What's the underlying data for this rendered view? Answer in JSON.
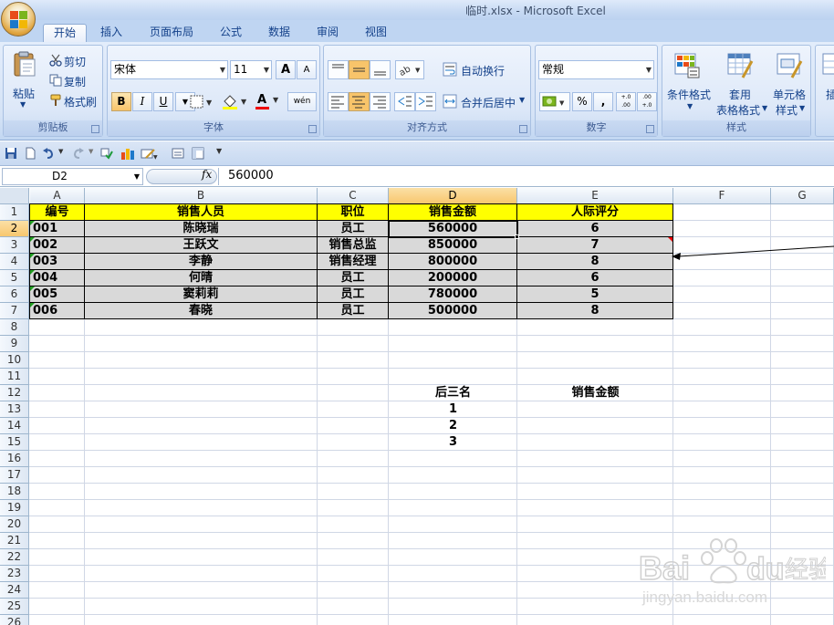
{
  "window": {
    "title": "临时.xlsx - Microsoft Excel"
  },
  "tabs": [
    "开始",
    "插入",
    "页面布局",
    "公式",
    "数据",
    "审阅",
    "视图"
  ],
  "ribbon": {
    "clipboard": {
      "label": "剪贴板",
      "paste": "粘贴",
      "cut": "剪切",
      "copy": "复制",
      "format_painter": "格式刷"
    },
    "font": {
      "label": "字体",
      "name": "宋体",
      "size": "11",
      "bold": "B",
      "italic": "I",
      "underline": "U",
      "grow": "A",
      "shrink": "A",
      "phonetic": "wén",
      "font_color_glyph": "A"
    },
    "alignment": {
      "label": "对齐方式",
      "wrap": "自动换行",
      "merge": "合并后居中"
    },
    "number": {
      "label": "数字",
      "format": "常规",
      "percent": "%",
      "comma": ",",
      "inc_decimal": "+.0 .00",
      "dec_decimal": ".00 +.0"
    },
    "styles": {
      "label": "样式",
      "conditional": "条件格式",
      "table_line1": "套用",
      "table_line2": "表格格式",
      "cell_line1": "单元格",
      "cell_line2": "样式"
    },
    "insert_partial": "插"
  },
  "formula_bar": {
    "name_box": "D2",
    "fx": "fx",
    "value": "560000"
  },
  "columns": [
    "A",
    "B",
    "C",
    "D",
    "E",
    "F",
    "G"
  ],
  "rows": [
    "1",
    "2",
    "3",
    "4",
    "5",
    "6",
    "7",
    "8",
    "9",
    "10",
    "11",
    "12",
    "13",
    "14",
    "15",
    "16",
    "17",
    "18",
    "19",
    "20",
    "21",
    "22",
    "23",
    "24",
    "25",
    "26"
  ],
  "table": {
    "headers": [
      "编号",
      "销售人员",
      "职位",
      "销售金额",
      "人际评分"
    ],
    "rows": [
      [
        "001",
        "陈晓瑞",
        "员工",
        "560000",
        "6"
      ],
      [
        "002",
        "王跃文",
        "销售总监",
        "850000",
        "7"
      ],
      [
        "003",
        "李静",
        "销售经理",
        "800000",
        "8"
      ],
      [
        "004",
        "何晴",
        "员工",
        "200000",
        "6"
      ],
      [
        "005",
        "窦莉莉",
        "员工",
        "780000",
        "5"
      ],
      [
        "006",
        "春晓",
        "员工",
        "500000",
        "8"
      ]
    ]
  },
  "extra": {
    "bottom3_label": "后三名",
    "sales_label": "销售金额",
    "ranks": [
      "1",
      "2",
      "3"
    ]
  },
  "watermark": {
    "brand": "Bai",
    "brand2": "du",
    "cn": "经验",
    "url": "jingyan.baidu.com"
  },
  "colors": {
    "header_fill": "#ffff00",
    "body_fill": "#d9d9d9",
    "accent": "#15428b"
  }
}
